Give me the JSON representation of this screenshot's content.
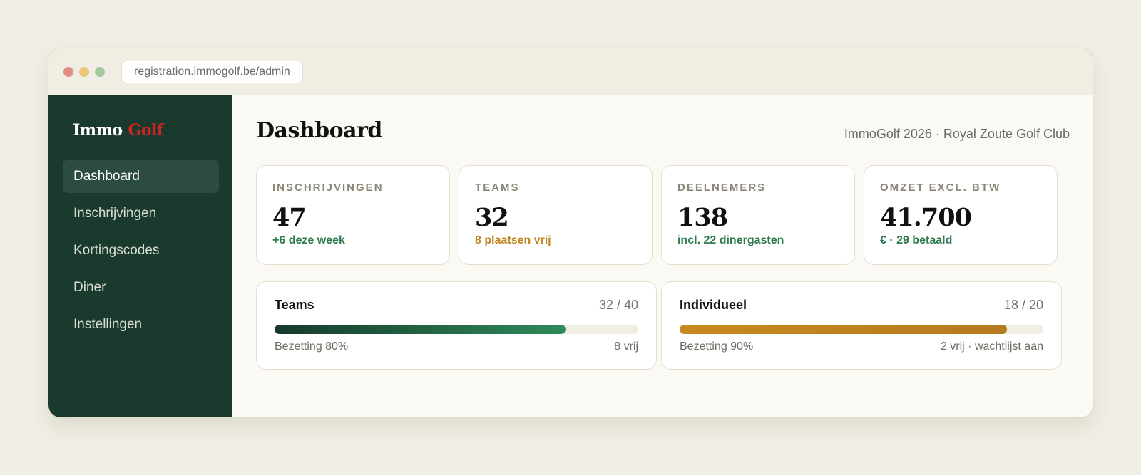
{
  "browser": {
    "url": "registration.immogolf.be/admin"
  },
  "sidebar": {
    "logo": {
      "word1": "Immo",
      "word2": "Golf"
    },
    "items": [
      {
        "label": "Dashboard",
        "active": true
      },
      {
        "label": "Inschrijvingen",
        "active": false
      },
      {
        "label": "Kortingscodes",
        "active": false
      },
      {
        "label": "Diner",
        "active": false
      },
      {
        "label": "Instellingen",
        "active": false
      }
    ]
  },
  "header": {
    "title": "Dashboard",
    "event": "ImmoGolf 2026 · Royal Zoute Golf Club"
  },
  "stats": [
    {
      "label": "INSCHRIJVINGEN",
      "value": "47",
      "sub": "+6 deze week",
      "sub_color": "green"
    },
    {
      "label": "TEAMS",
      "value": "32",
      "sub": "8 plaatsen vrij",
      "sub_color": "amber"
    },
    {
      "label": "DEELNEMERS",
      "value": "138",
      "sub": "incl. 22 dinergasten",
      "sub_color": "green"
    },
    {
      "label": "OMZET EXCL. BTW",
      "value": "41.700",
      "sub": "€ · 29 betaald",
      "sub_color": "green"
    }
  ],
  "capacity": [
    {
      "title": "Teams",
      "count": "32 / 40",
      "fill": 0.8,
      "left": "Bezetting 80%",
      "right": "8 vrij"
    },
    {
      "title": "Individueel",
      "count": "18 / 20",
      "fill": 0.9,
      "left": "Bezetting 90%",
      "right": "2 vrij · wachtlijst aan"
    }
  ],
  "colors": {
    "sidebar_bg": "#1a3a2e",
    "logo_accent": "#d42323",
    "positive": "#2e7a4f",
    "warning": "#c08520"
  }
}
